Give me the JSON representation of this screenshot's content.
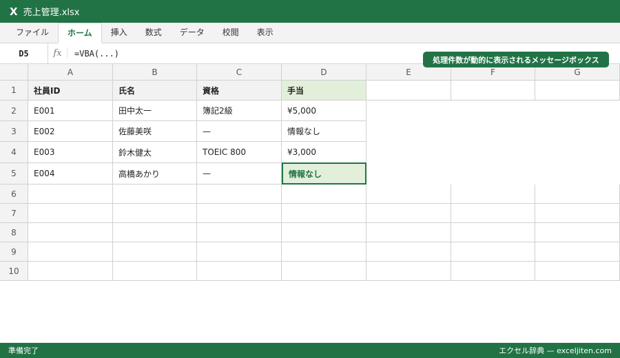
{
  "window": {
    "app_icon": "X",
    "title": "売上管理.xlsx"
  },
  "ribbon": {
    "tabs": [
      "ファイル",
      "ホーム",
      "挿入",
      "数式",
      "データ",
      "校閲",
      "表示"
    ],
    "active_index": 1
  },
  "formula_bar": {
    "cell_ref": "D5",
    "fx_label": "fx",
    "formula": "=VBA(...)"
  },
  "callout": {
    "text": "処理件数が動的に表示されるメッセージボックス"
  },
  "sheet": {
    "columns": [
      "A",
      "B",
      "C",
      "D",
      "E",
      "F",
      "G"
    ],
    "rows": [
      "1",
      "2",
      "3",
      "4",
      "5",
      "6",
      "7",
      "8",
      "9",
      "10"
    ],
    "header": [
      "社員ID",
      "氏名",
      "資格",
      "手当"
    ],
    "data": [
      [
        "E001",
        "田中太一",
        "簿記2級",
        "¥5,000"
      ],
      [
        "E002",
        "佐藤美咲",
        "—",
        "情報なし"
      ],
      [
        "E003",
        "鈴木健太",
        "TOEIC 800",
        "¥3,000"
      ],
      [
        "E004",
        "高橋あかり",
        "—",
        "情報なし"
      ]
    ],
    "selected_cell": "D5"
  },
  "statusbar": {
    "left": "準備完了",
    "right": "エクセル辞典 — exceljiten.com"
  },
  "colors": {
    "accent": "#217346",
    "header_fill": "#f2f2f2",
    "highlight_fill": "#e2efda"
  }
}
